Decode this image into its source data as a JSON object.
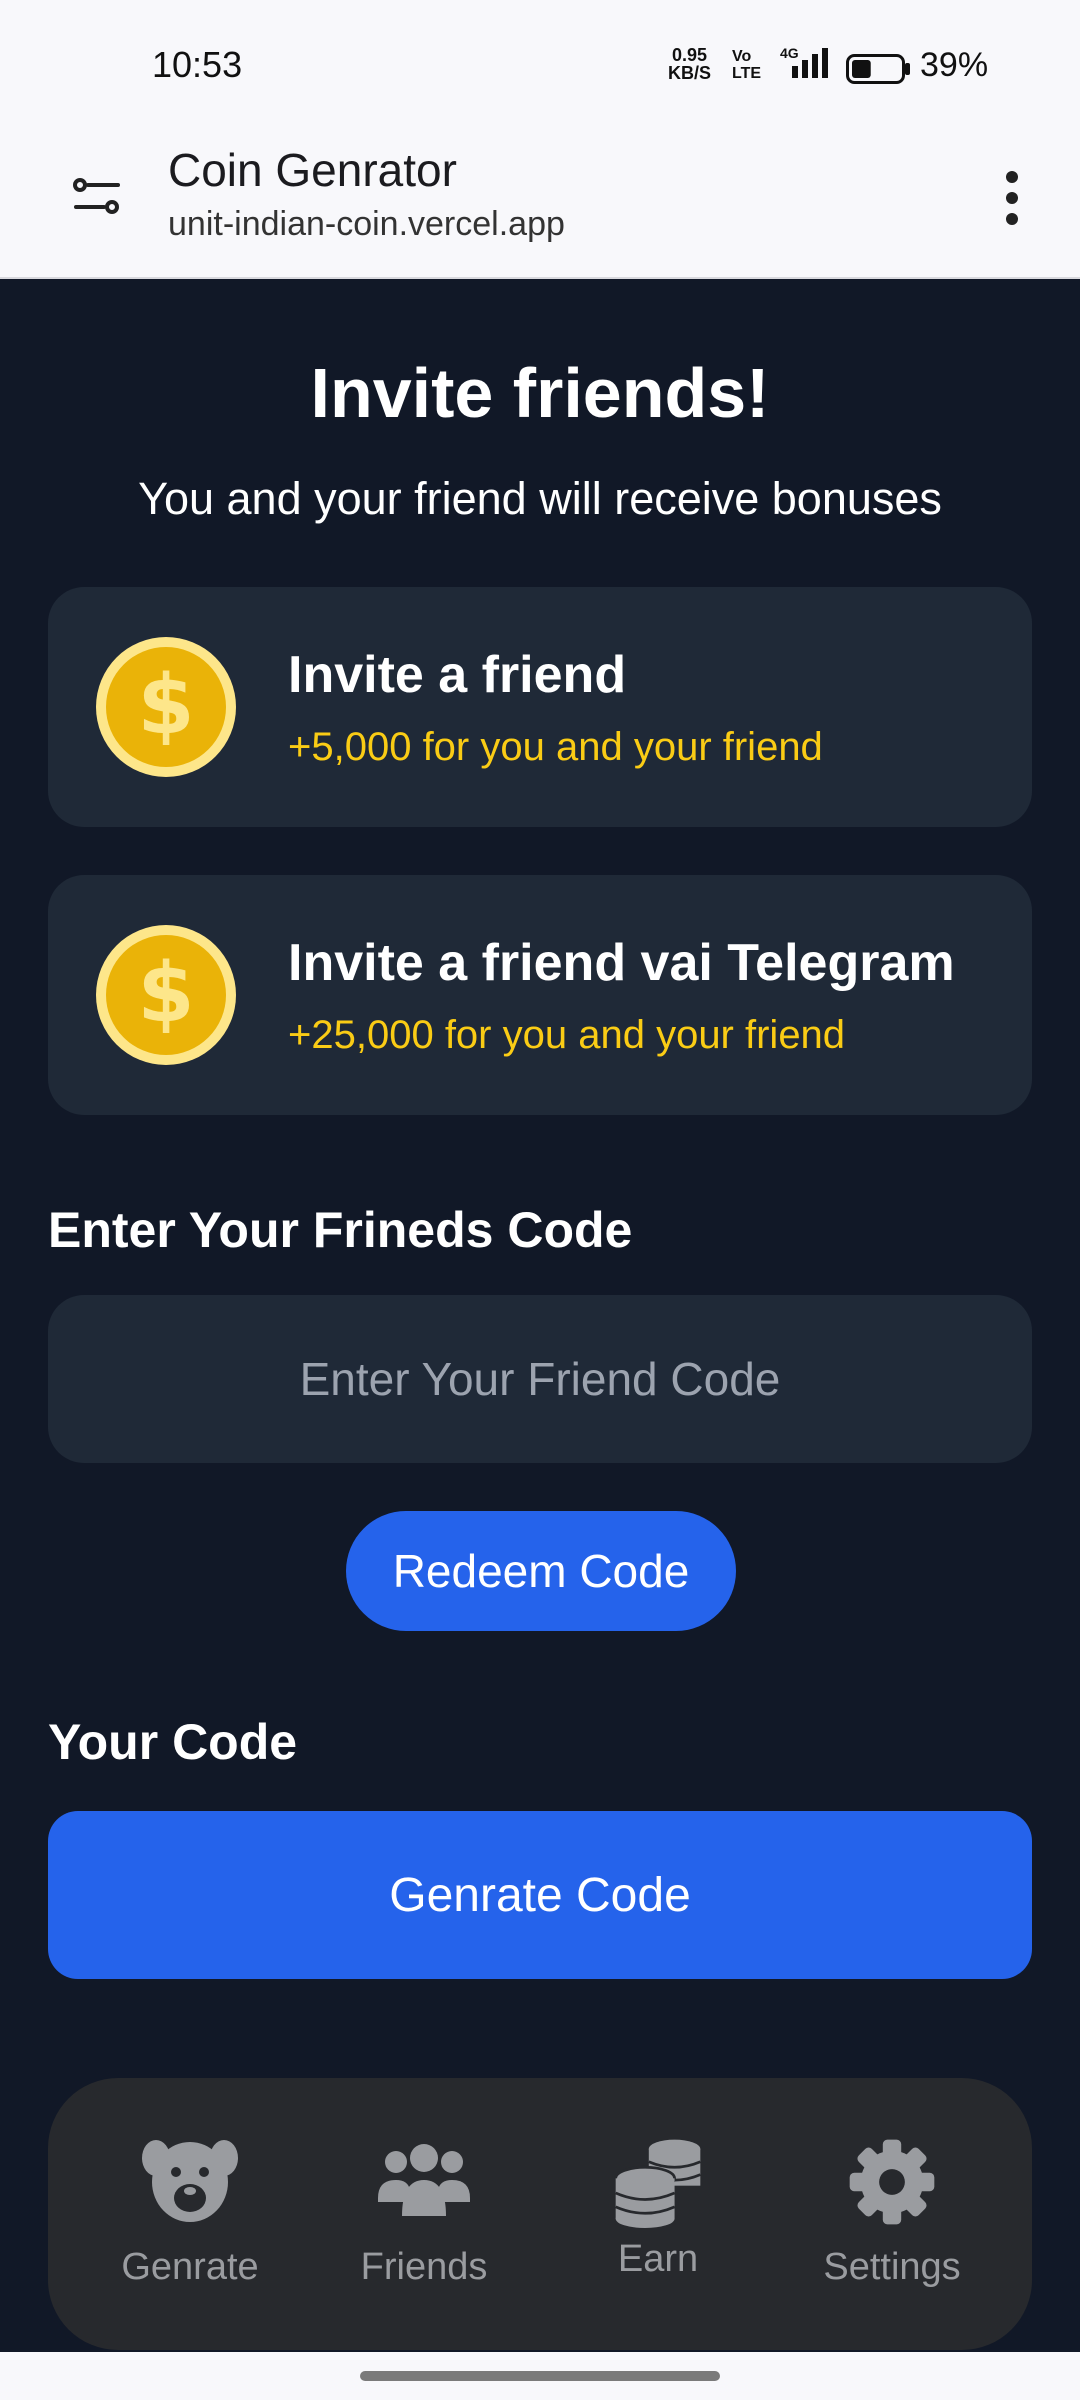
{
  "status_bar": {
    "time": "10:53",
    "net_speed_value": "0.95",
    "net_speed_unit": "KB/S",
    "volte_top": "Vo",
    "volte_bottom": "LTE",
    "network": "4G",
    "battery": "39%",
    "battery_level": 0.39
  },
  "browser": {
    "title": "Coin Genrator",
    "url": "unit-indian-coin.vercel.app",
    "icons": {
      "left": "tune-icon",
      "right": "more-vert-icon"
    }
  },
  "page": {
    "title": "Invite friends!",
    "subtitle": "You and your friend will receive bonuses",
    "cards": [
      {
        "title": "Invite a friend",
        "reward": "+5,000 for you and your friend",
        "icon": "dollar-coin-icon"
      },
      {
        "title": "Invite a friend vai Telegram",
        "reward": "+25,000 for you and your friend",
        "icon": "dollar-coin-icon"
      }
    ],
    "friend_code_label": "Enter Your Frineds Code",
    "friend_code_placeholder": "Enter Your Friend Code",
    "redeem_label": "Redeem Code",
    "your_code_label": "Your Code",
    "generate_label": "Genrate Code"
  },
  "bottom_nav": [
    {
      "label": "Genrate",
      "icon": "bear-face-icon"
    },
    {
      "label": "Friends",
      "icon": "users-icon"
    },
    {
      "label": "Earn",
      "icon": "coins-stack-icon"
    },
    {
      "label": "Settings",
      "icon": "gear-icon"
    }
  ],
  "colors": {
    "background": "#111827",
    "card": "#1f2937",
    "accent_blue": "#2563eb",
    "reward_yellow": "#facc15",
    "nav_bg": "#27292d",
    "nav_inactive": "#9a9ca0"
  }
}
